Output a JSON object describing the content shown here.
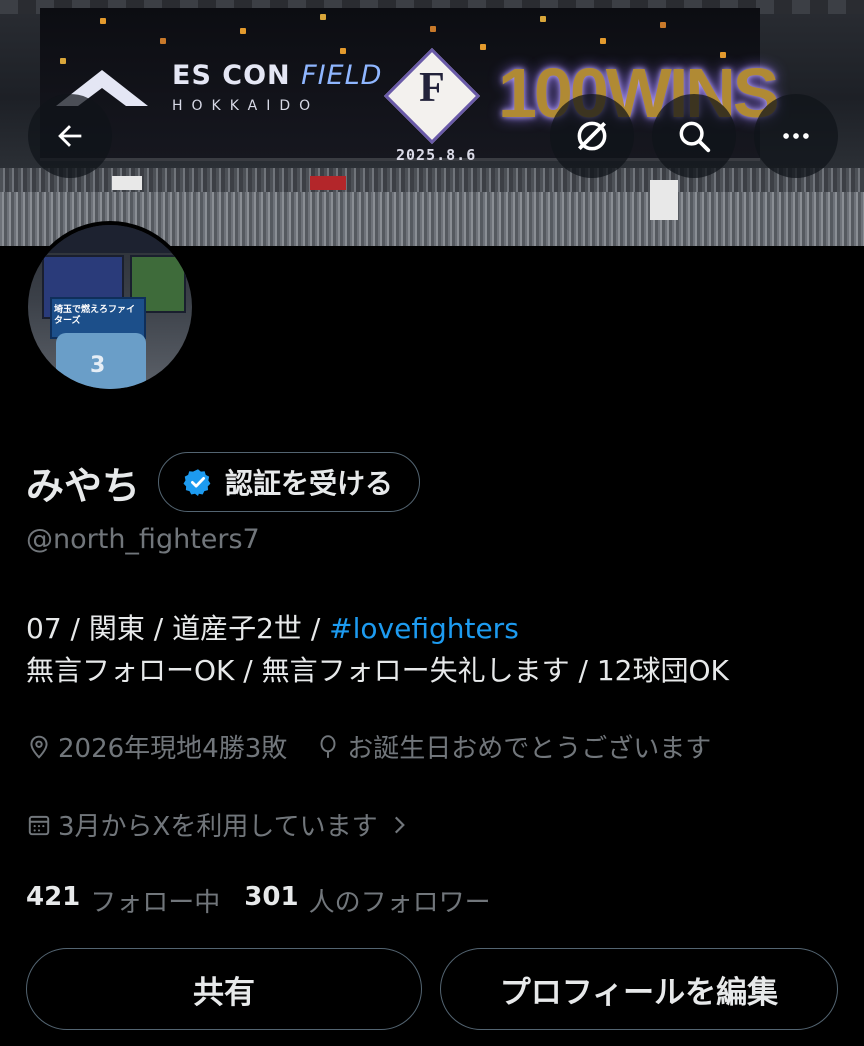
{
  "banner": {
    "venue_main": "ES CON",
    "venue_field": "FIELD",
    "venue_city": "HOKKAIDO",
    "venue_letter": "F",
    "date": "2025.8.6",
    "headline": "100WINS"
  },
  "top_bar": {
    "back_icon": "arrow-left-icon",
    "grok_icon": "slash-circle-icon",
    "search_icon": "search-icon",
    "more_icon": "more-horizontal-icon"
  },
  "avatar": {
    "flag_text": "埼玉で燃えろファイターズ",
    "shirt_number": "3"
  },
  "profile": {
    "display_name": "みやち",
    "verify_label": "認証を受ける",
    "handle": "@north_fighters7",
    "bio_line1_prefix": "07 / 関東 / 道産子2世 / ",
    "bio_hashtag": "#lovefighters",
    "bio_line2": "無言フォローOK / 無言フォロー失礼します / 12球団OK",
    "location": "2026年現地4勝3敗",
    "birthday": "お誕生日おめでとうございます",
    "joined": "3月からXを利用しています"
  },
  "stats": {
    "following_count": "421",
    "following_label": "フォロー中",
    "followers_count": "301",
    "followers_label": "人のフォロワー"
  },
  "actions": {
    "share_label": "共有",
    "edit_label": "プロフィールを編集"
  },
  "colors": {
    "background": "#000000",
    "text_primary": "#e7e9ea",
    "text_secondary": "#71767b",
    "accent": "#1d9bf0",
    "border": "#536471"
  }
}
